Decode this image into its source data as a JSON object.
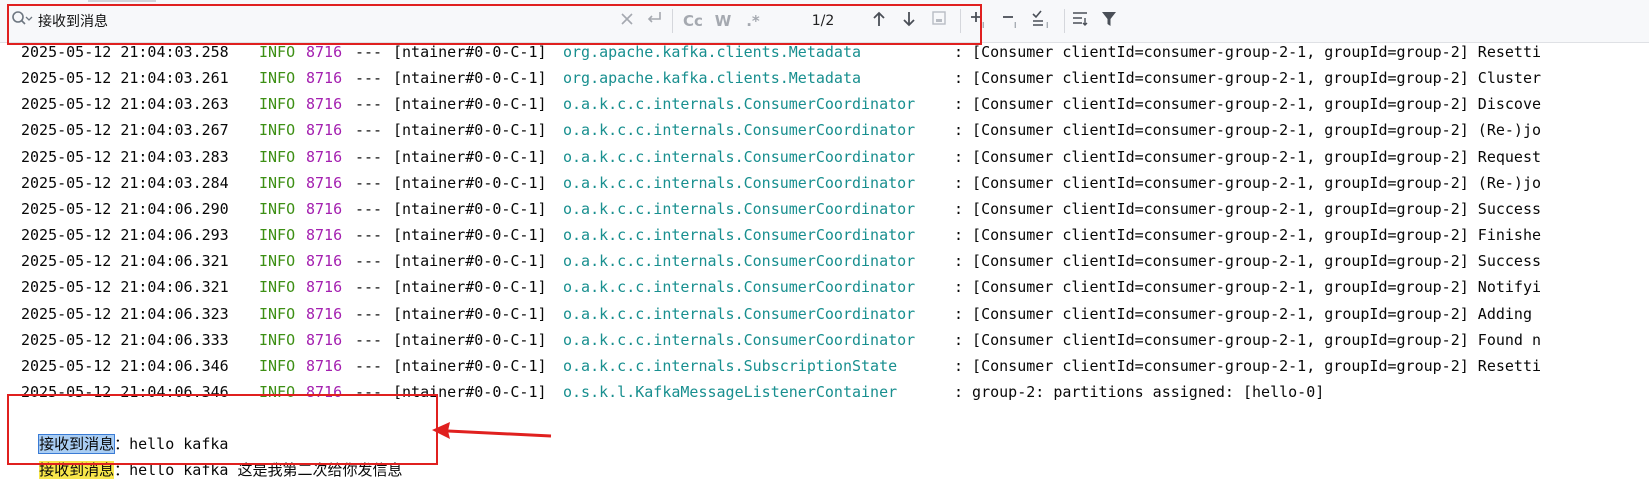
{
  "search": {
    "value": "接收到消息",
    "match_counter": "1/2",
    "case_label": "Cc",
    "words_label": "W",
    "regex_label": ".*"
  },
  "colors": {
    "highlight_box": "#e0201f",
    "log_level": "#3d8f14",
    "pid": "#a420b0",
    "logger": "#188f8f",
    "current_match": "#a9cdf3",
    "match": "#f7e64a"
  },
  "log_lines": [
    {
      "ts": "2025-05-12 21:04:03.258",
      "level": "INFO",
      "pid": "8716",
      "sep": "---",
      "thread": "[ntainer#0-0-C-1]",
      "logger": "org.apache.kafka.clients.Metadata",
      "msg": ": [Consumer clientId=consumer-group-2-1, groupId=group-2] Resetti"
    },
    {
      "ts": "2025-05-12 21:04:03.261",
      "level": "INFO",
      "pid": "8716",
      "sep": "---",
      "thread": "[ntainer#0-0-C-1]",
      "logger": "org.apache.kafka.clients.Metadata",
      "msg": ": [Consumer clientId=consumer-group-2-1, groupId=group-2] Cluster"
    },
    {
      "ts": "2025-05-12 21:04:03.263",
      "level": "INFO",
      "pid": "8716",
      "sep": "---",
      "thread": "[ntainer#0-0-C-1]",
      "logger": "o.a.k.c.c.internals.ConsumerCoordinator",
      "msg": ": [Consumer clientId=consumer-group-2-1, groupId=group-2] Discove"
    },
    {
      "ts": "2025-05-12 21:04:03.267",
      "level": "INFO",
      "pid": "8716",
      "sep": "---",
      "thread": "[ntainer#0-0-C-1]",
      "logger": "o.a.k.c.c.internals.ConsumerCoordinator",
      "msg": ": [Consumer clientId=consumer-group-2-1, groupId=group-2] (Re-)jo"
    },
    {
      "ts": "2025-05-12 21:04:03.283",
      "level": "INFO",
      "pid": "8716",
      "sep": "---",
      "thread": "[ntainer#0-0-C-1]",
      "logger": "o.a.k.c.c.internals.ConsumerCoordinator",
      "msg": ": [Consumer clientId=consumer-group-2-1, groupId=group-2] Request"
    },
    {
      "ts": "2025-05-12 21:04:03.284",
      "level": "INFO",
      "pid": "8716",
      "sep": "---",
      "thread": "[ntainer#0-0-C-1]",
      "logger": "o.a.k.c.c.internals.ConsumerCoordinator",
      "msg": ": [Consumer clientId=consumer-group-2-1, groupId=group-2] (Re-)jo"
    },
    {
      "ts": "2025-05-12 21:04:06.290",
      "level": "INFO",
      "pid": "8716",
      "sep": "---",
      "thread": "[ntainer#0-0-C-1]",
      "logger": "o.a.k.c.c.internals.ConsumerCoordinator",
      "msg": ": [Consumer clientId=consumer-group-2-1, groupId=group-2] Success"
    },
    {
      "ts": "2025-05-12 21:04:06.293",
      "level": "INFO",
      "pid": "8716",
      "sep": "---",
      "thread": "[ntainer#0-0-C-1]",
      "logger": "o.a.k.c.c.internals.ConsumerCoordinator",
      "msg": ": [Consumer clientId=consumer-group-2-1, groupId=group-2] Finishe"
    },
    {
      "ts": "2025-05-12 21:04:06.321",
      "level": "INFO",
      "pid": "8716",
      "sep": "---",
      "thread": "[ntainer#0-0-C-1]",
      "logger": "o.a.k.c.c.internals.ConsumerCoordinator",
      "msg": ": [Consumer clientId=consumer-group-2-1, groupId=group-2] Success"
    },
    {
      "ts": "2025-05-12 21:04:06.321",
      "level": "INFO",
      "pid": "8716",
      "sep": "---",
      "thread": "[ntainer#0-0-C-1]",
      "logger": "o.a.k.c.c.internals.ConsumerCoordinator",
      "msg": ": [Consumer clientId=consumer-group-2-1, groupId=group-2] Notifyi"
    },
    {
      "ts": "2025-05-12 21:04:06.323",
      "level": "INFO",
      "pid": "8716",
      "sep": "---",
      "thread": "[ntainer#0-0-C-1]",
      "logger": "o.a.k.c.c.internals.ConsumerCoordinator",
      "msg": ": [Consumer clientId=consumer-group-2-1, groupId=group-2] Adding "
    },
    {
      "ts": "2025-05-12 21:04:06.333",
      "level": "INFO",
      "pid": "8716",
      "sep": "---",
      "thread": "[ntainer#0-0-C-1]",
      "logger": "o.a.k.c.c.internals.ConsumerCoordinator",
      "msg": ": [Consumer clientId=consumer-group-2-1, groupId=group-2] Found n"
    },
    {
      "ts": "2025-05-12 21:04:06.346",
      "level": "INFO",
      "pid": "8716",
      "sep": "---",
      "thread": "[ntainer#0-0-C-1]",
      "logger": "o.a.k.c.c.internals.SubscriptionState",
      "msg": ": [Consumer clientId=consumer-group-2-1, groupId=group-2] Resetti"
    },
    {
      "ts": "2025-05-12 21:04:06.346",
      "level": "INFO",
      "pid": "8716",
      "sep": "---",
      "thread": "[ntainer#0-0-C-1]",
      "logger": "o.s.k.l.KafkaMessageListenerContainer",
      "msg": ": group-2: partitions assigned: [hello-0]"
    }
  ],
  "messages": [
    {
      "prefix": "接收到消息",
      "rest": "：hello kafka",
      "current": true
    },
    {
      "prefix": "接收到消息",
      "rest": "：hello kafka 这是我第二次给你发信息",
      "current": false
    }
  ]
}
